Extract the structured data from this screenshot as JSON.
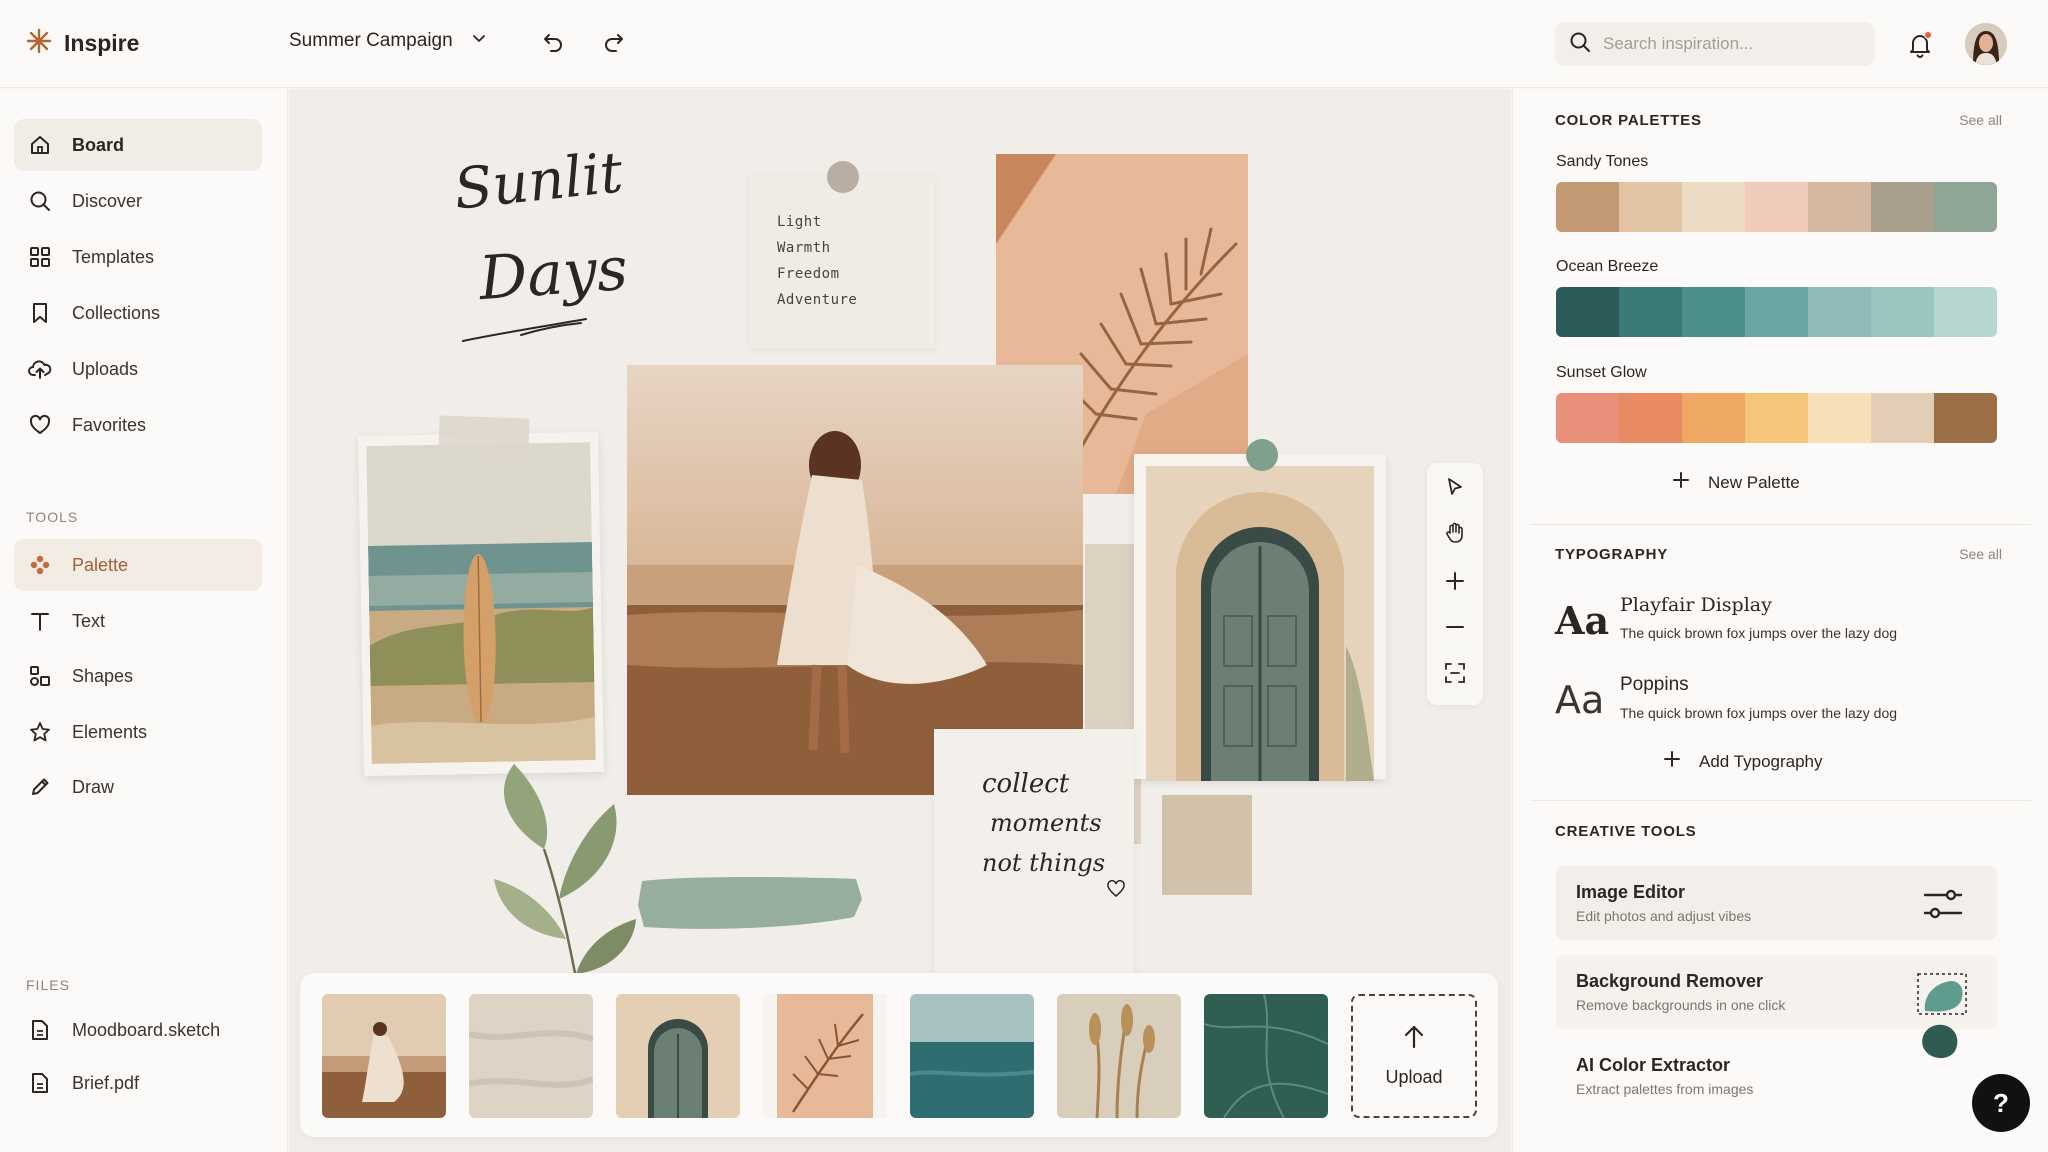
{
  "app": {
    "name": "Inspire"
  },
  "header": {
    "project_name": "Summer Campaign",
    "search_placeholder": "Search inspiration..."
  },
  "sidebar": {
    "nav": [
      {
        "label": "Board",
        "icon": "home-icon"
      },
      {
        "label": "Discover",
        "icon": "search-icon"
      },
      {
        "label": "Templates",
        "icon": "grid-icon"
      },
      {
        "label": "Collections",
        "icon": "bookmark-icon"
      },
      {
        "label": "Uploads",
        "icon": "cloud-upload-icon"
      },
      {
        "label": "Favorites",
        "icon": "heart-icon"
      }
    ],
    "tools_label": "TOOLS",
    "tools": [
      {
        "label": "Palette",
        "icon": "palette-icon"
      },
      {
        "label": "Text",
        "icon": "text-icon"
      },
      {
        "label": "Shapes",
        "icon": "shapes-icon"
      },
      {
        "label": "Elements",
        "icon": "star-icon"
      },
      {
        "label": "Draw",
        "icon": "pen-icon"
      }
    ],
    "files_label": "FILES",
    "files": [
      {
        "label": "Moodboard.sketch"
      },
      {
        "label": "Brief.pdf"
      }
    ]
  },
  "canvas": {
    "title_line1": "Sunlit",
    "title_line2": "Days",
    "note_lines": [
      "Light",
      "Warmth",
      "Freedom",
      "Adventure"
    ],
    "quote_lines": [
      "collect",
      "moments",
      "not things"
    ]
  },
  "filmstrip": {
    "thumbs": [
      "beach-woman",
      "linen-texture",
      "arched-door",
      "palm-leaf",
      "ocean",
      "dried-grass",
      "green-marble"
    ],
    "upload_label": "Upload"
  },
  "right_panel": {
    "palettes": {
      "title": "COLOR PALETTES",
      "see_all": "See all",
      "items": [
        {
          "name": "Sandy Tones",
          "colors": [
            "#c39a74",
            "#e2c4a5",
            "#ecdcc6",
            "#eecbba",
            "#d5b8a2",
            "#a8a08c",
            "#8fa595"
          ]
        },
        {
          "name": "Ocean Breeze",
          "colors": [
            "#2d5b57",
            "#3b7a76",
            "#4d8f8a",
            "#6ba6a2",
            "#8ebbb9",
            "#9bc5c1",
            "#b7d6d2"
          ]
        },
        {
          "name": "Sunset Glow",
          "colors": [
            "#e8907a",
            "#e88a62",
            "#efa764",
            "#f3c67c",
            "#f7e0b8",
            "#e2cdb6",
            "#9c7047"
          ]
        }
      ],
      "new_label": "New Palette"
    },
    "typography": {
      "title": "TYPOGRAPHY",
      "see_all": "See all",
      "items": [
        {
          "aa": "Aa",
          "name": "Playfair Display",
          "sample": "The quick brown fox jumps over the lazy dog"
        },
        {
          "aa": "Aa",
          "name": "Poppins",
          "sample": "The quick brown fox jumps over the lazy dog"
        }
      ],
      "add_label": "Add Typography"
    },
    "creative_tools": {
      "title": "CREATIVE TOOLS",
      "items": [
        {
          "name": "Image Editor",
          "desc": "Edit photos and adjust vibes"
        },
        {
          "name": "Background Remover",
          "desc": "Remove backgrounds in one click"
        },
        {
          "name": "AI Color Extractor",
          "desc": "Extract palettes from images"
        }
      ]
    }
  },
  "help_label": "?"
}
